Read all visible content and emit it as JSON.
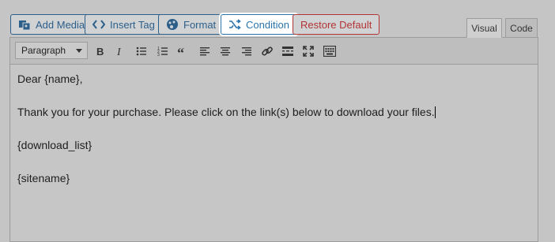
{
  "buttons": {
    "add_media": "Add Media",
    "insert_tag": "Insert Tag",
    "format": "Format",
    "condition": "Condition",
    "restore_default": "Restore Default"
  },
  "tabs": {
    "visual": "Visual",
    "code": "Code"
  },
  "toolbar": {
    "paragraph_select": "Paragraph",
    "icons": [
      "bold-icon",
      "italic-icon",
      "bullet-list-icon",
      "numbered-list-icon",
      "blockquote-icon",
      "align-left-icon",
      "align-center-icon",
      "align-right-icon",
      "link-icon",
      "read-more-icon",
      "fullscreen-icon",
      "toolbar-toggle-icon"
    ]
  },
  "content": {
    "lines": [
      "Dear {name},",
      "Thank you for your purchase. Please click on the link(s) below to download your files.",
      "{download_list}",
      "{sitename}"
    ]
  },
  "colors": {
    "primary": "#2c5f8a",
    "danger": "#b33434",
    "highlight": "#ffffff"
  }
}
